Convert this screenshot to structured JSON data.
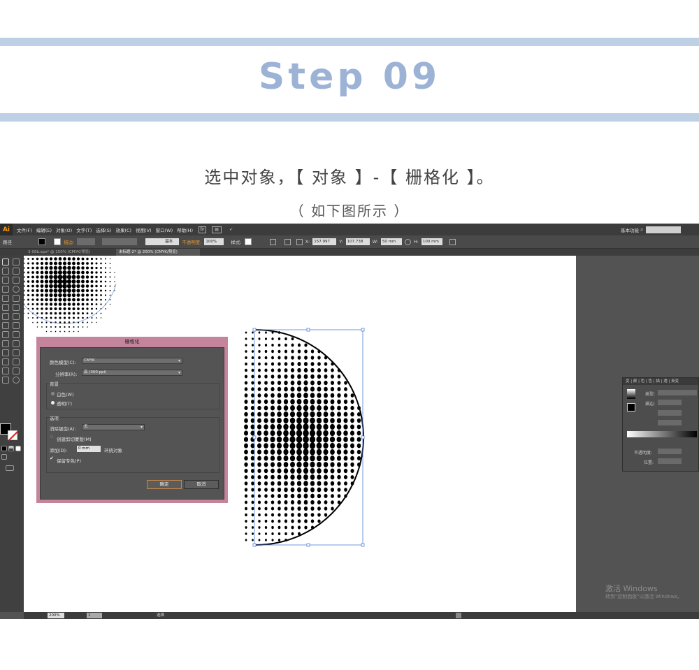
{
  "header": {
    "step_title": "Step 09",
    "caption_main": "选中对象，【 对象 】-【 栅格化 】。",
    "caption_sub": "（ 如下图所示 ）"
  },
  "app": {
    "logo": "Ai",
    "menu": [
      "文件(F)",
      "编辑(E)",
      "对象(O)",
      "文字(T)",
      "选择(S)",
      "效果(C)",
      "视图(V)",
      "窗口(W)",
      "帮助(H)"
    ],
    "workspace_label": "基本功能",
    "control_bar": {
      "path_label": "路径",
      "stroke_label": "描边:",
      "stroke_style_label": "基本",
      "opacity_label": "不透明度:",
      "opacity_value": "100%",
      "style_label": "样式:",
      "x_value": "157.997",
      "y_value": "107.738",
      "w_value": "50 mm",
      "h_value": "100 mm"
    },
    "tabs": [
      "3-08b.eps* @ 150% (CMYK/预览)",
      "未标题-2* @ 200% (CMYK/预览)"
    ],
    "status": {
      "zoom": "200%",
      "page": "1",
      "tool_label": "选择"
    },
    "gradient_panel": {
      "tabs": "变 | 颜 | 色 | 色 | 描 | 透 | 渐变",
      "type_label": "类型:",
      "stroke_label": "描边:",
      "opacity_label": "不透明度:",
      "position_label": "位置:"
    },
    "watermark": {
      "line1": "激活 Windows",
      "line2": "转到\"控制面板\"以激活 Windows。"
    }
  },
  "dialog": {
    "title": "栅格化",
    "color_model_label": "颜色模型(C):",
    "color_model_value": "CMYK",
    "resolution_label": "分辨率(R):",
    "resolution_value": "高 (300 ppi)",
    "background_label": "背景",
    "bg_white_label": "白色(W)",
    "bg_transparent_label": "透明(T)",
    "options_label": "选项",
    "antialias_label": "消除锯齿(A):",
    "antialias_value": "无",
    "clip_mask_label": "创建剪切蒙版(M)",
    "add_label": "添加(D):",
    "add_value": "0 mm",
    "surround_label": "环绕对象",
    "keep_spot_label": "保留专色(P)",
    "ok_label": "确定",
    "cancel_label": "取消"
  }
}
